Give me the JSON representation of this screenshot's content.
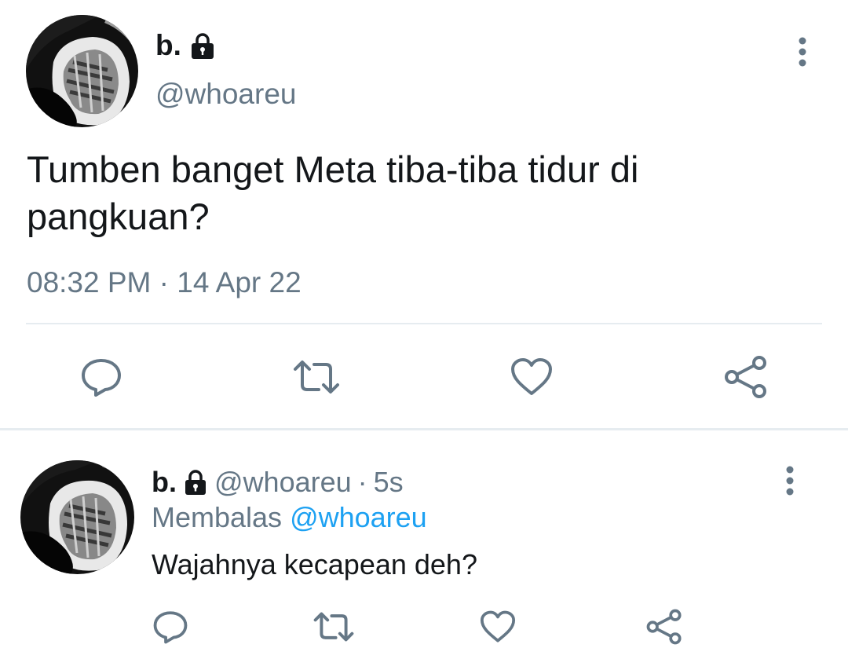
{
  "main_tweet": {
    "display_name": "b.",
    "handle": "@whoareu",
    "text": "Tumben banget Meta tiba-tiba tidur di pangkuan?",
    "timestamp": "08:32 PM · 14 Apr 22",
    "icons": {
      "lock": "lock-icon",
      "more": "more-vertical-icon",
      "reply": "reply-icon",
      "retweet": "retweet-icon",
      "like": "heart-icon",
      "share": "share-icon"
    }
  },
  "reply_tweet": {
    "display_name": "b.",
    "handle": "@whoareu",
    "separator": "·",
    "time": "5s",
    "replying_label": "Membalas",
    "replying_to": "@whoareu",
    "text": "Wajahnya kecapean deh?"
  },
  "colors": {
    "text_primary": "#14171a",
    "text_secondary": "#657786",
    "accent": "#1da1f2",
    "divider": "#e6ecf0"
  }
}
